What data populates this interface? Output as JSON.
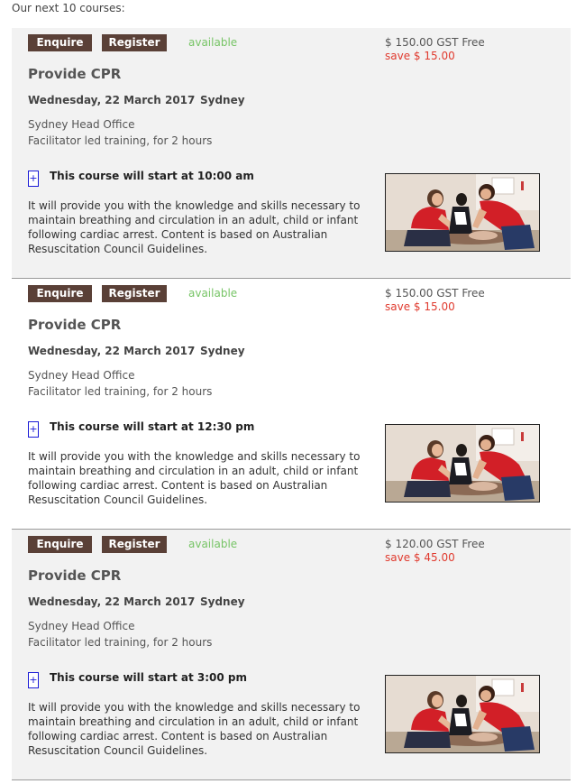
{
  "intro": "Our next 10 courses:",
  "courses": [
    {
      "enquire_label": "Enquire",
      "register_label": "Register",
      "availability": "available",
      "price": "$ 150.00 GST Free",
      "save": "save $ 15.00",
      "title": "Provide CPR",
      "date": "Wednesday, 22 March 2017",
      "city": "Sydney",
      "venue": "Sydney Head Office",
      "mode": "Facilitator led training, for 2 hours",
      "toggle": "+",
      "start": "This course will start at 10:00 am",
      "description": "It will provide you with the knowledge and skills necessary to maintain breathing and circulation in an adult, child or infant following cardiac arrest. Content is based on Australian Resuscitation Council Guidelines."
    },
    {
      "enquire_label": "Enquire",
      "register_label": "Register",
      "availability": "available",
      "price": "$ 150.00 GST Free",
      "save": "save $ 15.00",
      "title": "Provide CPR",
      "date": "Wednesday, 22 March 2017",
      "city": "Sydney",
      "venue": "Sydney Head Office",
      "mode": "Facilitator led training, for 2 hours",
      "toggle": "+",
      "start": "This course will start at 12:30 pm",
      "description": "It will provide you with the knowledge and skills necessary to maintain breathing and circulation in an adult, child or infant following cardiac arrest. Content is based on Australian Resuscitation Council Guidelines."
    },
    {
      "enquire_label": "Enquire",
      "register_label": "Register",
      "availability": "available",
      "price": "$ 120.00 GST Free",
      "save": "save $ 45.00",
      "title": "Provide CPR",
      "date": "Wednesday, 22 March 2017",
      "city": "Sydney",
      "venue": "Sydney Head Office",
      "mode": "Facilitator led training, for 2 hours",
      "toggle": "+",
      "start": "This course will start at 3:00 pm",
      "description": "It will provide you with the knowledge and skills necessary to maintain breathing and circulation in an adult, child or infant following cardiac arrest. Content is based on Australian Resuscitation Council Guidelines."
    }
  ],
  "colors": {
    "button_bg": "#5a4037",
    "available": "#77c466",
    "save": "#e03a2e",
    "toggle_border": "#1a1ad6",
    "card_bg": "#f2f2f2"
  }
}
